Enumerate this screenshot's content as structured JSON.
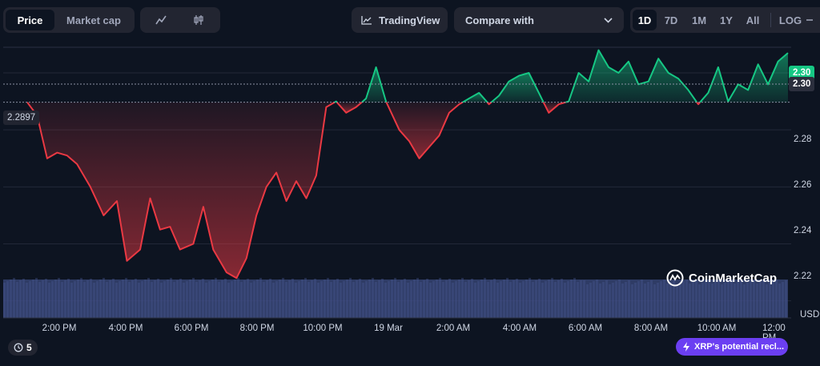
{
  "toolbar": {
    "price_tab": "Price",
    "market_cap_tab": "Market cap",
    "line_chart_icon": "line-chart-icon",
    "candle_chart_icon": "candlestick-icon",
    "tradingview_label": "TradingView",
    "compare_label": "Compare with",
    "ranges": [
      "1D",
      "7D",
      "1M",
      "1Y",
      "All"
    ],
    "active_range": "1D",
    "log_label": "LOG"
  },
  "chart": {
    "open_price_label": "2.2897",
    "current_price_label": "2.30",
    "current_price_top_label": "2.30",
    "currency_label": "USD",
    "watermark": "CoinMarketCap",
    "colors": {
      "up": "#16c784",
      "down": "#ea3943",
      "volume": "#3b4a7e",
      "background": "#0d1421"
    }
  },
  "chart_data": {
    "type": "area",
    "baseline": 2.2897,
    "ylim": [
      2.214,
      2.309
    ],
    "y_ticks": [
      "2.22",
      "2.24",
      "2.26",
      "2.28"
    ],
    "x_tick_labels": [
      "2:00 PM",
      "4:00 PM",
      "6:00 PM",
      "8:00 PM",
      "10:00 PM",
      "19 Mar",
      "2:00 AM",
      "4:00 AM",
      "6:00 AM",
      "8:00 AM",
      "10:00 AM",
      "12:00 PM"
    ],
    "x": [
      0,
      0.3,
      0.6,
      0.9,
      1.2,
      1.5,
      1.9,
      2.3,
      2.7,
      3.0,
      3.4,
      3.7,
      4.0,
      4.3,
      4.6,
      5.0,
      5.3,
      5.6,
      6.0,
      6.3,
      6.6,
      6.9,
      7.2,
      7.5,
      7.8,
      8.1,
      8.4,
      8.7,
      9.0,
      9.3,
      9.6,
      9.9,
      10.2,
      10.5,
      10.8,
      11.2,
      11.5,
      11.8,
      12.1,
      12.4,
      12.7,
      13.0,
      13.3,
      13.6,
      13.9,
      14.2,
      14.5,
      14.8,
      15.1,
      15.4,
      15.7,
      16.0,
      16.3,
      16.6,
      16.9,
      17.2,
      17.5,
      17.8,
      18.1,
      18.4,
      18.7,
      19.0,
      19.3,
      19.6,
      19.9,
      20.2,
      20.5,
      20.8,
      21.1,
      21.4,
      21.7,
      22.0,
      22.3,
      22.6,
      22.9
    ],
    "values": [
      2.2897,
      2.285,
      2.27,
      2.272,
      2.271,
      2.268,
      2.26,
      2.25,
      2.255,
      2.234,
      2.238,
      2.256,
      2.245,
      2.246,
      2.238,
      2.24,
      2.253,
      2.238,
      2.23,
      2.228,
      2.235,
      2.25,
      2.26,
      2.265,
      2.255,
      2.262,
      2.256,
      2.264,
      2.288,
      2.29,
      2.286,
      2.288,
      2.291,
      2.302,
      2.29,
      2.28,
      2.276,
      2.27,
      2.274,
      2.278,
      2.286,
      2.289,
      2.291,
      2.293,
      2.289,
      2.292,
      2.297,
      2.299,
      2.3,
      2.293,
      2.286,
      2.289,
      2.29,
      2.3,
      2.297,
      2.308,
      2.302,
      2.3,
      2.304,
      2.296,
      2.297,
      2.305,
      2.3,
      2.298,
      2.294,
      2.289,
      2.293,
      2.302,
      2.29,
      2.296,
      2.294,
      2.303,
      2.296,
      2.304,
      2.307
    ],
    "volume_note": "volume bars along bottom"
  },
  "footer": {
    "alert_count": "5",
    "news_pill": "XRP's potential recl..."
  }
}
